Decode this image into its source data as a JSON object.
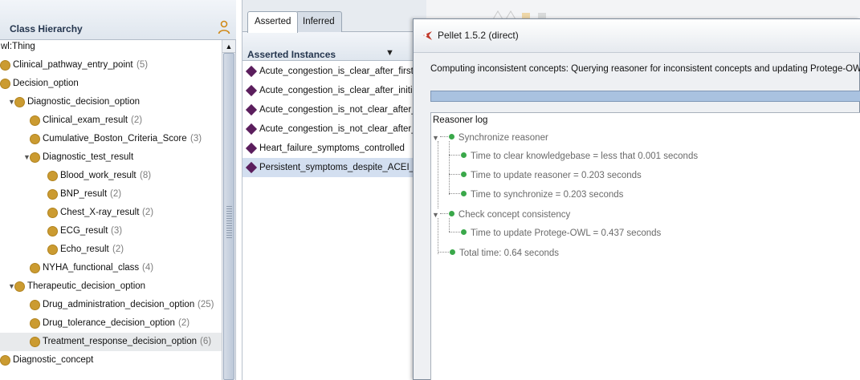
{
  "class_hierarchy": {
    "title": "Class Hierarchy",
    "rows": [
      {
        "label": "wl:Thing",
        "count": "",
        "depth": 0,
        "expanded": null,
        "icon": false,
        "selected": false
      },
      {
        "label": "Clinical_pathway_entry_point",
        "count": "(5)",
        "depth": 0,
        "expanded": null,
        "icon": true,
        "selected": false
      },
      {
        "label": "Decision_option",
        "count": "",
        "depth": 0,
        "expanded": null,
        "icon": true,
        "selected": false
      },
      {
        "label": "Diagnostic_decision_option",
        "count": "",
        "depth": 0,
        "expanded": true,
        "icon": true,
        "selected": false
      },
      {
        "label": "Clinical_exam_result",
        "count": "(2)",
        "depth": 1,
        "expanded": null,
        "icon": true,
        "selected": false
      },
      {
        "label": "Cumulative_Boston_Criteria_Score",
        "count": "(3)",
        "depth": 1,
        "expanded": null,
        "icon": true,
        "selected": false
      },
      {
        "label": "Diagnostic_test_result",
        "count": "",
        "depth": 1,
        "expanded": true,
        "icon": true,
        "selected": false
      },
      {
        "label": "Blood_work_result",
        "count": "(8)",
        "depth": 2,
        "expanded": null,
        "icon": true,
        "selected": false
      },
      {
        "label": "BNP_result",
        "count": "(2)",
        "depth": 2,
        "expanded": null,
        "icon": true,
        "selected": false
      },
      {
        "label": "Chest_X-ray_result",
        "count": "(2)",
        "depth": 2,
        "expanded": null,
        "icon": true,
        "selected": false
      },
      {
        "label": "ECG_result",
        "count": "(3)",
        "depth": 2,
        "expanded": null,
        "icon": true,
        "selected": false
      },
      {
        "label": "Echo_result",
        "count": "(2)",
        "depth": 2,
        "expanded": null,
        "icon": true,
        "selected": false
      },
      {
        "label": "NYHA_functional_class",
        "count": "(4)",
        "depth": 1,
        "expanded": null,
        "icon": true,
        "selected": false
      },
      {
        "label": "Therapeutic_decision_option",
        "count": "",
        "depth": 0,
        "expanded": true,
        "icon": true,
        "selected": false
      },
      {
        "label": "Drug_administration_decision_option",
        "count": "(25)",
        "depth": 1,
        "expanded": null,
        "icon": true,
        "selected": false
      },
      {
        "label": "Drug_tolerance_decision_option",
        "count": "(2)",
        "depth": 1,
        "expanded": null,
        "icon": true,
        "selected": false
      },
      {
        "label": "Treatment_response_decision_option",
        "count": "(6)",
        "depth": 1,
        "expanded": null,
        "icon": true,
        "selected": true
      },
      {
        "label": "Diagnostic_concept",
        "count": "",
        "depth": 0,
        "expanded": null,
        "icon": true,
        "selected": false
      }
    ]
  },
  "tabs": [
    {
      "label": "Asserted",
      "active": true
    },
    {
      "label": "Inferred",
      "active": false
    }
  ],
  "instances": {
    "title": "Asserted Instances",
    "items": [
      {
        "label": "Acute_congestion_is_clear_after_first_",
        "selected": false
      },
      {
        "label": "Acute_congestion_is_clear_after_initia",
        "selected": false
      },
      {
        "label": "Acute_congestion_is_not_clear_after_",
        "selected": false
      },
      {
        "label": "Acute_congestion_is_not_clear_after_",
        "selected": false
      },
      {
        "label": "Heart_failure_symptoms_controlled",
        "selected": false
      },
      {
        "label": "Persistent_symptoms_despite_ACEI_or",
        "selected": true
      }
    ]
  },
  "dialog": {
    "title": "Pellet 1.5.2 (direct)",
    "status": "Computing inconsistent concepts: Querying reasoner for inconsistent concepts and updating Protege-OWL...",
    "log_title": "Reasoner log",
    "log": {
      "sync": "Synchronize reasoner",
      "sync_1": "Time to clear knowledgebase = less that 0.001 seconds",
      "sync_2": "Time to update reasoner = 0.203 seconds",
      "sync_3": "Time to synchronize = 0.203 seconds",
      "check": "Check concept consistency",
      "check_1": "Time to update Protege-OWL = 0.437 seconds",
      "total": "Total time: 0.64 seconds"
    }
  },
  "colors": {
    "class_icon": "#cb9b31",
    "instance_icon": "#5b1e5d",
    "log_node": "#3aa84a",
    "selection": "#d3dff0"
  },
  "icons": [
    "person-icon",
    "class-icon",
    "instance-icon",
    "expand-triangle-icon",
    "pellet-icon",
    "log-node-icon"
  ]
}
